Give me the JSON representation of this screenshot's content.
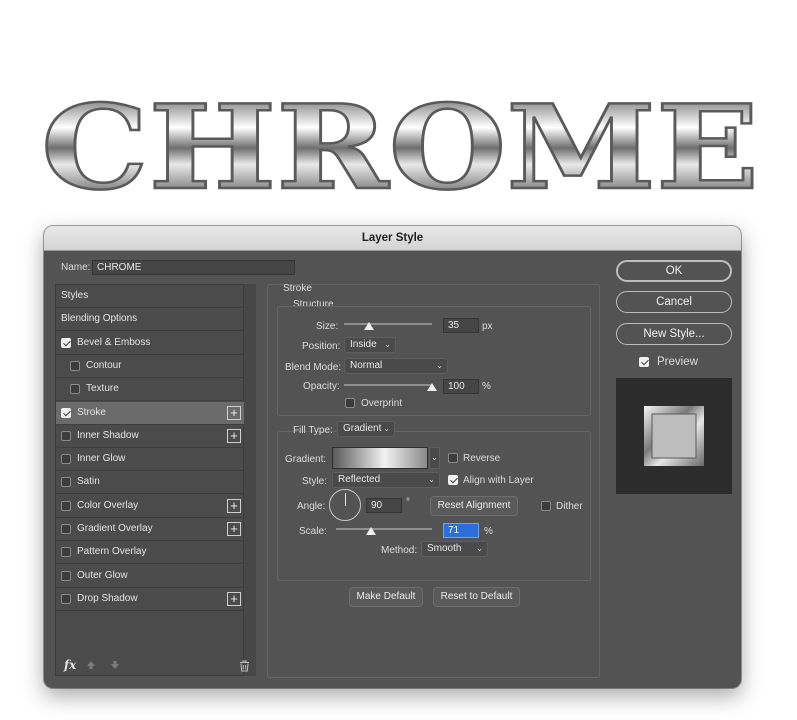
{
  "banner": {
    "text": "CHROME"
  },
  "dialog": {
    "title": "Layer Style",
    "name_label": "Name:",
    "name_value": "CHROME",
    "list": {
      "items": [
        {
          "label": "Styles"
        },
        {
          "label": "Blending Options"
        },
        {
          "label": "Bevel & Emboss",
          "checked": true
        },
        {
          "label": "Contour",
          "checked": false
        },
        {
          "label": "Texture",
          "checked": false
        },
        {
          "label": "Stroke",
          "checked": true,
          "selected": true
        },
        {
          "label": "Inner Shadow",
          "checked": false
        },
        {
          "label": "Inner Glow",
          "checked": false
        },
        {
          "label": "Satin",
          "checked": false
        },
        {
          "label": "Color Overlay",
          "checked": false
        },
        {
          "label": "Gradient Overlay",
          "checked": false
        },
        {
          "label": "Pattern Overlay",
          "checked": false
        },
        {
          "label": "Outer Glow",
          "checked": false
        },
        {
          "label": "Drop Shadow",
          "checked": false
        }
      ],
      "fx_label": "fx"
    },
    "stroke": {
      "heading": "Stroke",
      "structure_heading": "Structure",
      "size_label": "Size:",
      "size_value": "35",
      "size_unit": "px",
      "size_fraction": 0.28,
      "position_label": "Position:",
      "position_value": "Inside",
      "blend_label": "Blend Mode:",
      "blend_value": "Normal",
      "opacity_label": "Opacity:",
      "opacity_value": "100",
      "opacity_unit": "%",
      "opacity_fraction": 1.0,
      "overprint_label": "Overprint",
      "filltype_label": "Fill Type:",
      "filltype_value": "Gradient",
      "gradient_label": "Gradient:",
      "reverse_label": "Reverse",
      "style_label": "Style:",
      "style_value": "Reflected",
      "align_label": "Align with Layer",
      "angle_label": "Angle:",
      "angle_value": "90",
      "angle_unit": "°",
      "reset_alignment_label": "Reset Alignment",
      "dither_label": "Dither",
      "scale_label": "Scale:",
      "scale_value": "71",
      "scale_unit": "%",
      "scale_fraction": 0.36,
      "method_label": "Method:",
      "method_value": "Smooth",
      "make_default_label": "Make Default",
      "reset_default_label": "Reset to Default"
    },
    "buttons": {
      "ok": "OK",
      "cancel": "Cancel",
      "new_style": "New Style...",
      "preview_label": "Preview"
    }
  },
  "colors": {
    "panel": "#535353",
    "accent": "#2d6fd6",
    "title_bar": "#dedede"
  }
}
